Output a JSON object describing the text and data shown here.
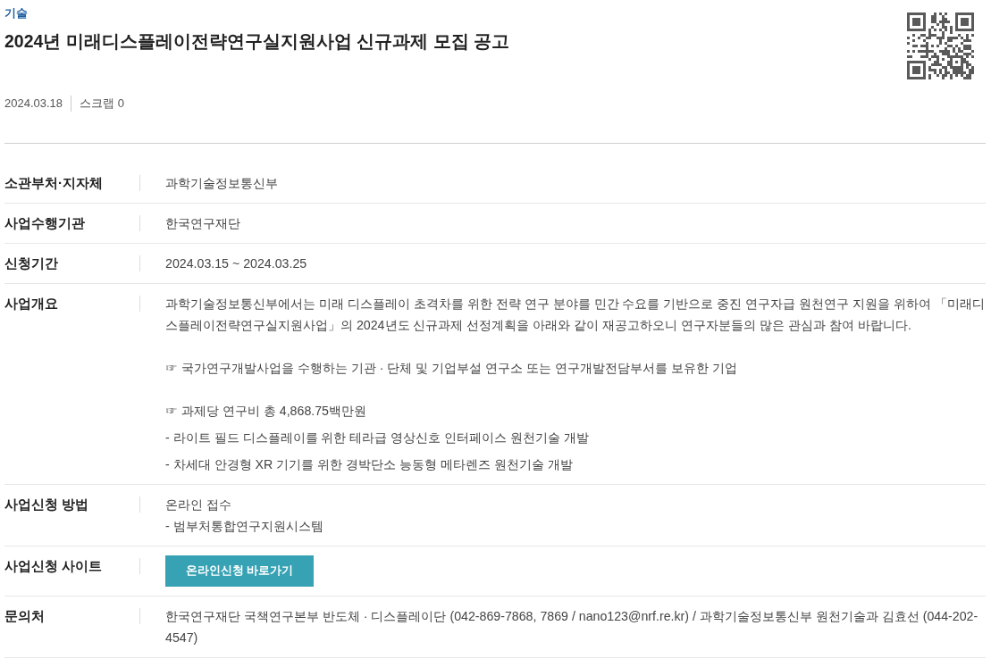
{
  "category": "기술",
  "title": "2024년 미래디스플레이전략연구실지원사업 신규과제 모집 공고",
  "meta": {
    "date": "2024.03.18",
    "scrap": "스크랩 0"
  },
  "details": [
    {
      "kind": "text",
      "label": "소관부처·지자체",
      "lines": [
        "과학기술정보통신부"
      ]
    },
    {
      "kind": "text",
      "label": "사업수행기관",
      "lines": [
        "한국연구재단"
      ]
    },
    {
      "kind": "text",
      "label": "신청기간",
      "lines": [
        "2024.03.15 ~ 2024.03.25"
      ]
    },
    {
      "kind": "blocks",
      "label": "사업개요",
      "blocks": [
        [
          "과학기술정보통신부에서는 미래 디스플레이 초격차를 위한 전략 연구 분야를 민간 수요를 기반으로 중진 연구자급 원천연구 지원을 위하여 「미래디스플레이전략연구실지원사업」의 2024년도 신규과제 선정계획을 아래와 같이 재공고하오니 연구자분들의 많은 관심과 참여 바랍니다."
        ],
        [
          "☞ 국가연구개발사업을 수행하는 기관 · 단체 및 기업부설 연구소 또는 연구개발전담부서를 보유한 기업"
        ],
        [
          "☞ 과제당 연구비 총 4,868.75백만원",
          "- 라이트 필드 디스플레이를 위한 테라급 영상신호 인터페이스 원천기술 개발",
          "- 차세대 안경형 XR 기기를 위한 경박단소 능동형 메타렌즈 원천기술 개발"
        ]
      ]
    },
    {
      "kind": "text",
      "label": "사업신청 방법",
      "lines": [
        "온라인 접수",
        "- 범부처통합연구지원시스템"
      ]
    },
    {
      "kind": "button",
      "label": "사업신청 사이트",
      "button": "온라인신청 바로가기"
    },
    {
      "kind": "text",
      "label": "문의처",
      "lines": [
        "한국연구재단 국책연구본부 반도체 · 디스플레이단 (042-869-7868, 7869 / nano123@nrf.re.kr) / 과학기술정보통신부 원천기술과 김효선 (044-202-4547)"
      ]
    }
  ]
}
